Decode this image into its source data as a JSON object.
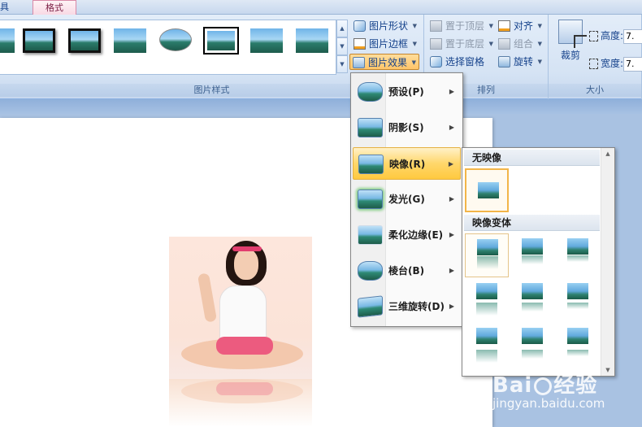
{
  "tabs": {
    "tools_partial": "具",
    "format": "格式"
  },
  "ribbon": {
    "picture_styles": {
      "label": "图片样式",
      "gallery_items": [
        "simple-frame",
        "thick-black-frame",
        "black-frame-shadow",
        "soft-edge",
        "oval",
        "double-frame",
        "black-frame",
        "soft-rect"
      ],
      "shape_button": "图片形状",
      "border_button": "图片边框",
      "effects_button": "图片效果"
    },
    "arrange": {
      "label": "排列",
      "bring_front": "置于顶层",
      "send_back": "置于底层",
      "selection_pane": "选择窗格",
      "align": "对齐",
      "group": "组合",
      "rotate": "旋转"
    },
    "size": {
      "label": "大小",
      "crop": "裁剪",
      "height_label": "高度:",
      "height_value": "7.",
      "width_label": "宽度:",
      "width_value": "7."
    }
  },
  "effects_menu": {
    "items": [
      {
        "label": "预设(P)"
      },
      {
        "label": "阴影(S)"
      },
      {
        "label": "映像(R)"
      },
      {
        "label": "发光(G)"
      },
      {
        "label": "柔化边缘(E)"
      },
      {
        "label": "棱台(B)"
      },
      {
        "label": "三维旋转(D)"
      }
    ],
    "highlighted": "映像(R)"
  },
  "reflection_submenu": {
    "no_reflection_header": "无映像",
    "variations_header": "映像变体"
  },
  "watermark": {
    "logo_text_1": "Bai",
    "logo_text_2": "经验",
    "url": "jingyan.baidu.com"
  },
  "colors": {
    "accent_highlight": "#ffc93f",
    "ribbon_bg": "#d5e3f4",
    "workspace_bg": "#a9c2e2"
  }
}
